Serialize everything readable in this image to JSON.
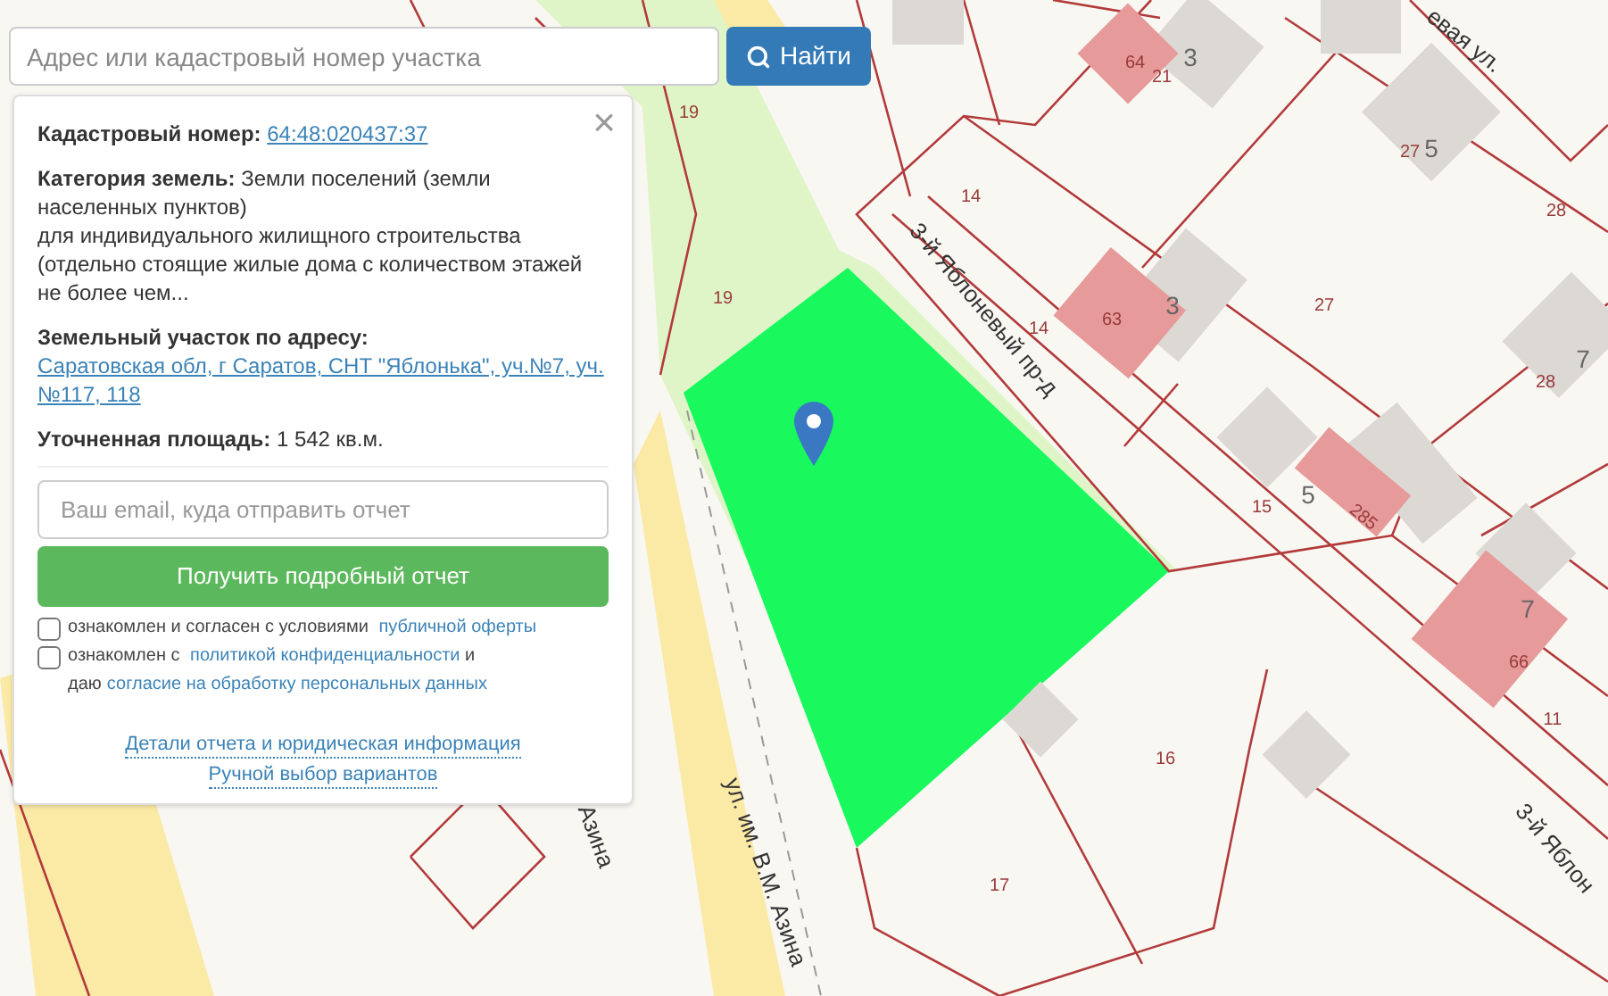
{
  "search": {
    "placeholder": "Адрес или кадастровый номер участка",
    "button": "Найти"
  },
  "info_panel": {
    "close": "×",
    "cadastral": {
      "label": "Кадастровый номер:",
      "value": "64:48:020437:37"
    },
    "category": {
      "label": "Категория земель:",
      "value": "Земли поселений (земли населенных пунктов)",
      "detail": "для индивидуального жилищного строительства (отдельно стоящие жилые дома с количеством этажей не более чем..."
    },
    "address": {
      "label": "Земельный участок по адресу:",
      "value": "Саратовская обл, г Саратов, СНТ \"Яблонька\", уч.№7, уч.№117, 118"
    },
    "area": {
      "label": "Уточненная площадь:",
      "value": "1 542 кв.м."
    },
    "email": {
      "placeholder": "Ваш email, куда отправить отчет"
    },
    "submit": "Получить подробный отчет",
    "agreements": [
      {
        "checked": false,
        "parts": [
          {
            "text": "ознакомлен и согласен с условиями ",
            "link": false
          },
          {
            "text": "публичной оферты",
            "link": true
          }
        ]
      },
      {
        "checked": false,
        "parts": [
          {
            "text": "ознакомлен с ",
            "link": false
          },
          {
            "text": "политикой конфиденциальности",
            "link": true
          },
          {
            "text": " и даю",
            "link": false
          },
          {
            "text": "согласие на обработку персональных данных",
            "link": true
          }
        ]
      }
    ],
    "links": [
      "Детали отчета и юридическая информация",
      "Ручной выбор вариантов"
    ]
  },
  "map": {
    "labels": [
      {
        "text": "19",
        "kind": "number"
      },
      {
        "text": "19",
        "kind": "number"
      },
      {
        "text": "14",
        "kind": "number"
      },
      {
        "text": "64",
        "kind": "number"
      },
      {
        "text": "21",
        "kind": "number"
      },
      {
        "text": "3",
        "kind": "house"
      },
      {
        "text": "евая ул.",
        "kind": "street"
      },
      {
        "text": "27",
        "kind": "number"
      },
      {
        "text": "5",
        "kind": "house"
      },
      {
        "text": "28",
        "kind": "number"
      },
      {
        "text": "3-й Яблоневый пр-д",
        "kind": "street"
      },
      {
        "text": "14",
        "kind": "number"
      },
      {
        "text": "63",
        "kind": "number"
      },
      {
        "text": "3",
        "kind": "house"
      },
      {
        "text": "27",
        "kind": "number"
      },
      {
        "text": "7",
        "kind": "house"
      },
      {
        "text": "28",
        "kind": "number"
      },
      {
        "text": "15",
        "kind": "number"
      },
      {
        "text": "5",
        "kind": "house"
      },
      {
        "text": "285",
        "kind": "number"
      },
      {
        "text": "7",
        "kind": "house"
      },
      {
        "text": "66",
        "kind": "number"
      },
      {
        "text": "11",
        "kind": "number"
      },
      {
        "text": "16",
        "kind": "number"
      },
      {
        "text": "17",
        "kind": "number"
      },
      {
        "text": "3-й Яблон",
        "kind": "street"
      },
      {
        "text": "ул. им. В.М. Азина",
        "kind": "street"
      },
      {
        "text": "Азина",
        "kind": "street"
      }
    ]
  }
}
